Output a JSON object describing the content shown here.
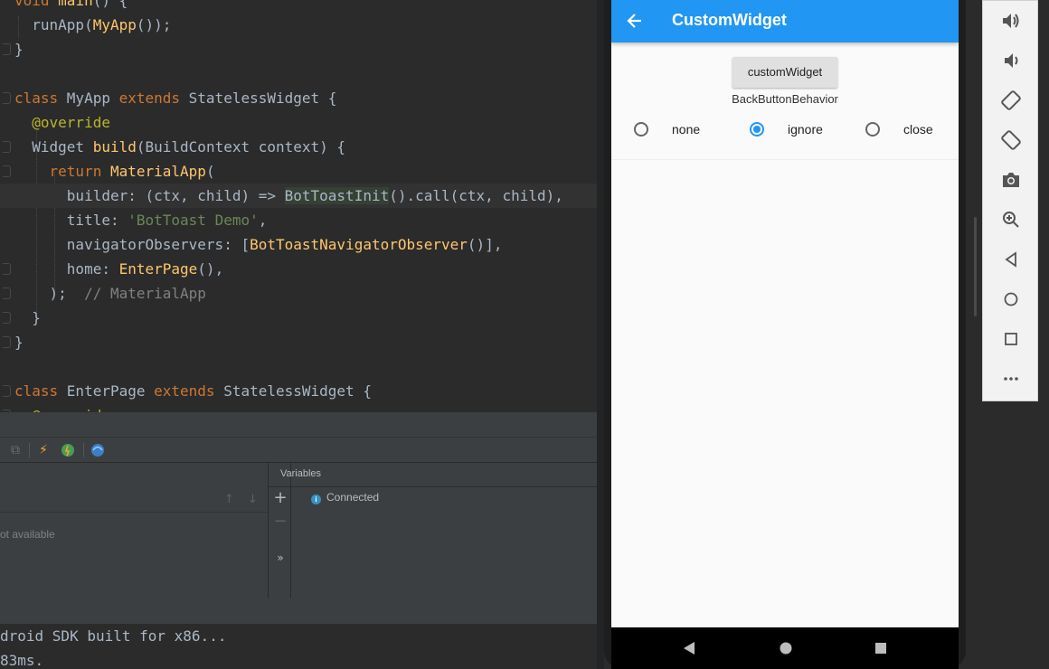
{
  "editor": {
    "lines": [
      {
        "parts": [
          [
            "kw",
            "void "
          ],
          [
            "fn",
            "main"
          ],
          [
            "",
            "() {"
          ]
        ]
      },
      {
        "parts": [
          [
            "",
            "  runApp("
          ],
          [
            "cls",
            "MyApp"
          ],
          [
            "",
            "());"
          ]
        ]
      },
      {
        "parts": [
          [
            "",
            "}"
          ]
        ]
      },
      {
        "parts": [
          [
            "",
            ""
          ]
        ]
      },
      {
        "parts": [
          [
            "kw",
            "class "
          ],
          [
            "",
            "MyApp "
          ],
          [
            "kw",
            "extends "
          ],
          [
            "",
            "StatelessWidget {"
          ]
        ]
      },
      {
        "parts": [
          [
            "ann",
            "  @override"
          ]
        ]
      },
      {
        "parts": [
          [
            "",
            "  Widget "
          ],
          [
            "fn",
            "build"
          ],
          [
            "",
            "(BuildContext context) {"
          ]
        ]
      },
      {
        "parts": [
          [
            "kw",
            "    return "
          ],
          [
            "cls",
            "MaterialApp"
          ],
          [
            "",
            "("
          ]
        ]
      },
      {
        "parts": [
          [
            "",
            "      builder: (ctx, child) => "
          ],
          [
            "hlbox",
            "BotToastInit"
          ],
          [
            "",
            "().call(ctx, child),"
          ]
        ]
      },
      {
        "parts": [
          [
            "",
            "      title: "
          ],
          [
            "str",
            "'BotToast Demo'"
          ],
          [
            "",
            ","
          ]
        ]
      },
      {
        "parts": [
          [
            "",
            "      navigatorObservers: ["
          ],
          [
            "cls",
            "BotToastNavigatorObserver"
          ],
          [
            "",
            "()],"
          ]
        ]
      },
      {
        "parts": [
          [
            "",
            "      home: "
          ],
          [
            "cls",
            "EnterPage"
          ],
          [
            "",
            "(),"
          ]
        ]
      },
      {
        "parts": [
          [
            "",
            "    );  "
          ],
          [
            "cmt",
            "// MaterialApp"
          ]
        ]
      },
      {
        "parts": [
          [
            "",
            "  }"
          ]
        ]
      },
      {
        "parts": [
          [
            "",
            "}"
          ]
        ]
      },
      {
        "parts": [
          [
            "",
            ""
          ]
        ]
      },
      {
        "parts": [
          [
            "kw",
            "class "
          ],
          [
            "",
            "EnterPage "
          ],
          [
            "kw",
            "extends "
          ],
          [
            "",
            "StatelessWidget {"
          ]
        ]
      },
      {
        "parts": [
          [
            "ann",
            "  @override"
          ]
        ]
      }
    ]
  },
  "debug": {
    "variables_title": "Variables",
    "connected_label": "Connected",
    "frames_status": "ot available"
  },
  "console": {
    "lines": [
      "droid SDK built for x86...",
      "83ms."
    ]
  },
  "app": {
    "title": "CustomWidget",
    "button_label": "customWidget",
    "behavior_label": "BackButtonBehavior",
    "radio_options": [
      "none",
      "ignore",
      "close"
    ],
    "selected_option": "ignore",
    "accent_color": "#2196f3"
  },
  "emulator_controls": [
    "volume-up-icon",
    "volume-down-icon",
    "rotate-left-icon",
    "rotate-right-icon",
    "camera-icon",
    "zoom-icon",
    "back-icon",
    "home-icon",
    "overview-icon",
    "more-icon"
  ]
}
